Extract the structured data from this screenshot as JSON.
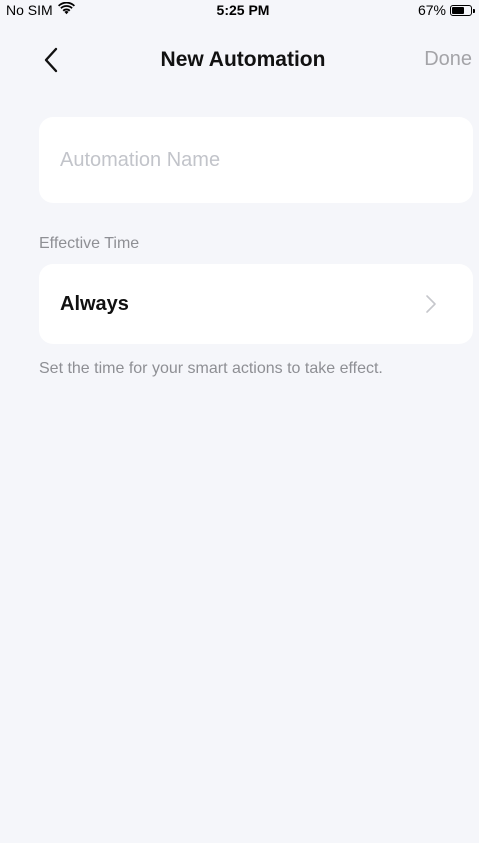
{
  "status_bar": {
    "carrier": "No SIM",
    "time": "5:25 PM",
    "battery_percent": "67%",
    "battery_level": 0.67,
    "wifi_icon": "wifi-icon",
    "battery_icon": "battery-icon"
  },
  "nav": {
    "back_icon": "chevron-left-icon",
    "title": "New Automation",
    "done_label": "Done"
  },
  "form": {
    "name_field": {
      "value": "",
      "placeholder": "Automation Name"
    },
    "effective_time_label": "Effective Time",
    "effective_time_value": "Always",
    "effective_time_icon": "chevron-right-icon",
    "hint": "Set the time for your smart actions to take effect."
  },
  "colors": {
    "background": "#f5f6fa",
    "card": "#ffffff",
    "primary_text": "#111111",
    "secondary_text": "#8e8f94",
    "placeholder": "#c2c4ca",
    "disabled_action": "#a4a4a8"
  }
}
